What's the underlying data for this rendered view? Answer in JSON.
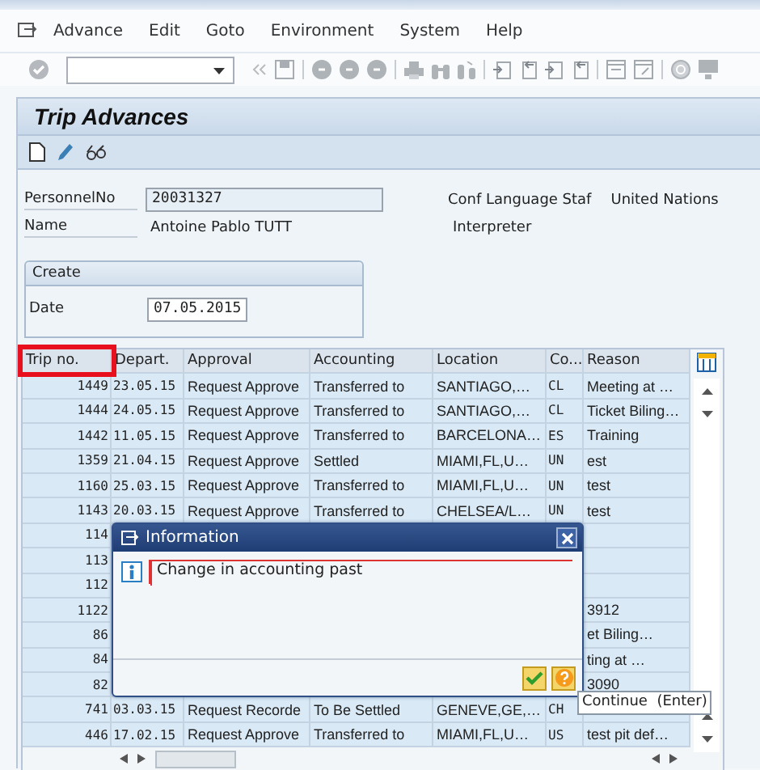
{
  "menu": [
    {
      "label": "Advance"
    },
    {
      "label": "Edit"
    },
    {
      "label": "Goto"
    },
    {
      "label": "Environment"
    },
    {
      "label": "System"
    },
    {
      "label": "Help"
    }
  ],
  "screen_title": "Trip Advances",
  "header": {
    "personnel_label": "PersonnelNo",
    "personnel_value": "20031327",
    "name_label": "Name",
    "name_value": "Antoine Pablo TUTT",
    "org_unit": "Conf Language Staf",
    "organization": "United Nations",
    "position": "Interpreter"
  },
  "create": {
    "title": "Create",
    "date_label": "Date",
    "date_value": "07.05.2015"
  },
  "table": {
    "columns": [
      "Trip no.",
      "Depart.",
      "Approval",
      "Accounting",
      "Location",
      "Co...",
      "Reason"
    ],
    "rows": [
      {
        "trip": "1449",
        "depart": "23.05.15",
        "approval": "Request Approve",
        "accounting": "Transferred to",
        "location": "SANTIAGO,…",
        "country": "CL",
        "reason": "Meeting at …"
      },
      {
        "trip": "1444",
        "depart": "24.05.15",
        "approval": "Request Approve",
        "accounting": "Transferred to",
        "location": "SANTIAGO,…",
        "country": "CL",
        "reason": "Ticket Biling…"
      },
      {
        "trip": "1442",
        "depart": "11.05.15",
        "approval": "Request Approve",
        "accounting": "Transferred to",
        "location": "BARCELONA…",
        "country": "ES",
        "reason": "Training"
      },
      {
        "trip": "1359",
        "depart": "21.04.15",
        "approval": "Request Approve",
        "accounting": "Settled",
        "location": "MIAMI,FL,U…",
        "country": "UN",
        "reason": "est"
      },
      {
        "trip": "1160",
        "depart": "25.03.15",
        "approval": "Request Approve",
        "accounting": "Transferred to",
        "location": "MIAMI,FL,U…",
        "country": "UN",
        "reason": "test"
      },
      {
        "trip": "1143",
        "depart": "20.03.15",
        "approval": "Request Approve",
        "accounting": "Transferred to",
        "location": "CHELSEA/L…",
        "country": "UN",
        "reason": "test"
      },
      {
        "trip": "114"
      },
      {
        "trip": "113"
      },
      {
        "trip": "112"
      },
      {
        "trip": "1122",
        "reason": "3912"
      },
      {
        "trip": "86",
        "reason": "et Biling…"
      },
      {
        "trip": "84",
        "reason": "ting at …"
      },
      {
        "trip": "82",
        "reason": "3090"
      },
      {
        "trip": "741",
        "depart": "03.03.15",
        "approval": "Request Recorde",
        "accounting": "To Be Settled",
        "location": "GENEVE,GE,…",
        "country": "CH"
      },
      {
        "trip": "446",
        "depart": "17.02.15",
        "approval": "Request Approve",
        "accounting": "Transferred to",
        "location": "MIAMI,FL,U…",
        "country": "US",
        "reason": "test pit def…"
      }
    ]
  },
  "dialog": {
    "title": "Information",
    "message": "Change in accounting past"
  },
  "tooltip": "Continue  (Enter)"
}
